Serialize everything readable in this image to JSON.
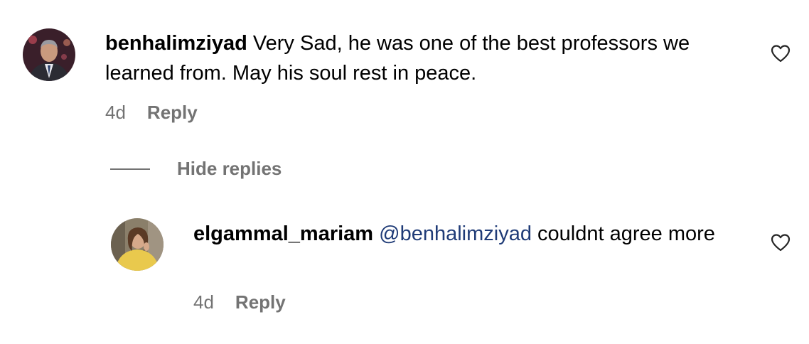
{
  "comments": [
    {
      "username": "benhalimziyad",
      "text": "Very Sad, he was one of the best professors we learned from. May his soul rest in peace.",
      "time": "4d",
      "reply_label": "Reply"
    }
  ],
  "hide_replies_label": "Hide replies",
  "replies": [
    {
      "username": "elgammal_mariam",
      "mention": "@benhalimziyad",
      "text": "couldnt agree more",
      "time": "4d",
      "reply_label": "Reply"
    }
  ],
  "icons": {
    "like": "heart-outline-icon"
  }
}
